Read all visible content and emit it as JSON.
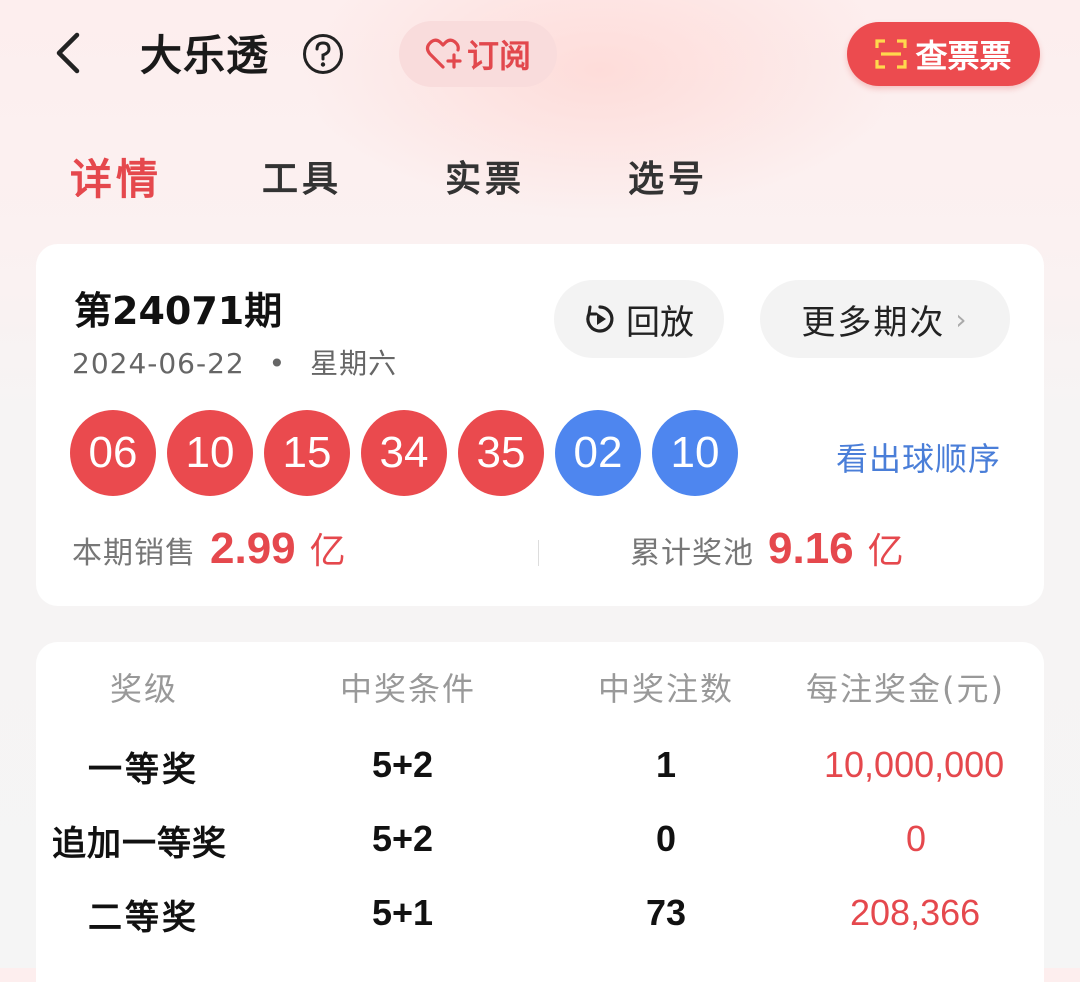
{
  "header": {
    "title": "大乐透",
    "subscribe_label": "订阅",
    "check_ticket_label": "查票票"
  },
  "tabs": [
    {
      "label": "详情",
      "active": true
    },
    {
      "label": "工具",
      "active": false
    },
    {
      "label": "实票",
      "active": false
    },
    {
      "label": "选号",
      "active": false
    }
  ],
  "draw": {
    "issue": "第24071期",
    "date": "2024-06-22",
    "separator": "•",
    "weekday": "星期六",
    "replay_label": "回放",
    "more_issues_label": "更多期次",
    "front_balls": [
      "06",
      "10",
      "15",
      "34",
      "35"
    ],
    "back_balls": [
      "02",
      "10"
    ],
    "order_link": "看出球顺序",
    "sales_label": "本期销售",
    "sales_value": "2.99",
    "sales_unit": "亿",
    "pool_label": "累计奖池",
    "pool_value": "9.16",
    "pool_unit": "亿"
  },
  "prize_table": {
    "headers": [
      "奖级",
      "中奖条件",
      "中奖注数",
      "每注奖金(元)"
    ],
    "rows": [
      {
        "level": "一等奖",
        "condition": "5+2",
        "count": "1",
        "amount": "10,000,000"
      },
      {
        "level": "追加一等奖",
        "condition": "5+2",
        "count": "0",
        "amount": "0"
      },
      {
        "level": "二等奖",
        "condition": "5+1",
        "count": "73",
        "amount": "208,366"
      }
    ]
  },
  "colors": {
    "accent_red": "#e5484d",
    "ball_red": "#ea4a4e",
    "ball_blue": "#4e86ef",
    "link_blue": "#4a7ed8"
  }
}
